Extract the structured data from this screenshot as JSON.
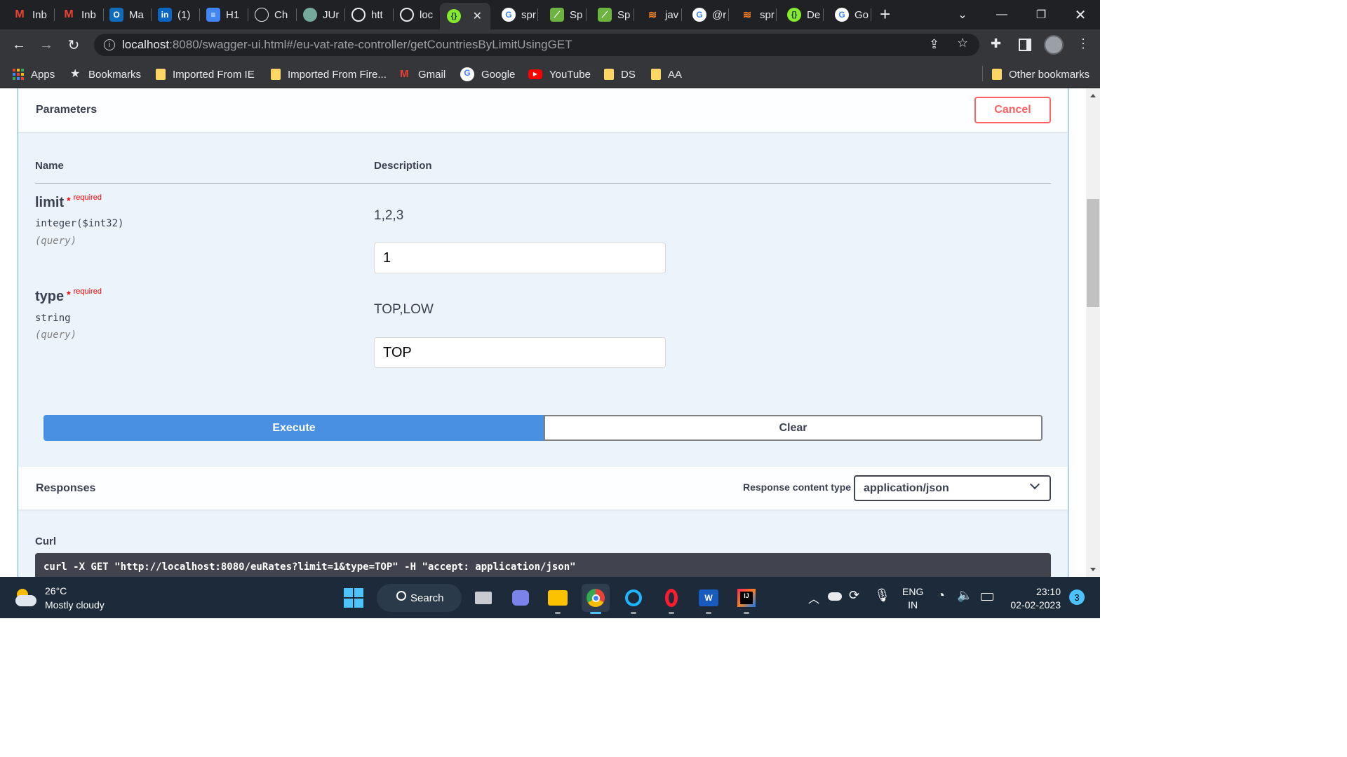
{
  "browser": {
    "tabs": [
      {
        "label": "Inb",
        "icon": "gmail-icon",
        "color": "#ea4335"
      },
      {
        "label": "Inb",
        "icon": "gmail-icon",
        "color": "#ea4335"
      },
      {
        "label": "Ma",
        "icon": "outlook-icon",
        "color": "#0f6cbd"
      },
      {
        "label": "(1)",
        "icon": "linkedin-icon",
        "color": "#0a66c2"
      },
      {
        "label": "H1",
        "icon": "docs-icon",
        "color": "#4285f4"
      },
      {
        "label": "Ch",
        "icon": "openai-icon",
        "color": "#202124"
      },
      {
        "label": "JUr",
        "icon": "openai-icon",
        "color": "#74aa9c"
      },
      {
        "label": "htt",
        "icon": "globe-icon",
        "color": "#5f6368"
      },
      {
        "label": "loc",
        "icon": "globe-icon",
        "color": "#5f6368"
      },
      {
        "label": "",
        "icon": "swagger-icon",
        "color": "#85ea2d",
        "active": true
      },
      {
        "label": "spr",
        "icon": "google-icon",
        "color": "#ffffff"
      },
      {
        "label": "Sp",
        "icon": "spring-icon",
        "color": "#6db33f"
      },
      {
        "label": "Sp",
        "icon": "spring-icon",
        "color": "#6db33f"
      },
      {
        "label": "jav",
        "icon": "stackoverflow-icon",
        "color": "#f48024"
      },
      {
        "label": "@r",
        "icon": "google-icon",
        "color": "#ffffff"
      },
      {
        "label": "spr",
        "icon": "stackoverflow-icon",
        "color": "#f48024"
      },
      {
        "label": "De",
        "icon": "swagger-icon",
        "color": "#85ea2d"
      },
      {
        "label": "Go",
        "icon": "google-icon",
        "color": "#ffffff"
      }
    ],
    "url_host": "localhost",
    "url_rest": ":8080/swagger-ui.html#/eu-vat-rate-controller/getCountriesByLimitUsingGET",
    "bookmarks": [
      {
        "label": "Apps",
        "icon": "apps-icon"
      },
      {
        "label": "Bookmarks",
        "icon": "star-icon"
      },
      {
        "label": "Imported From IE",
        "icon": "folder-icon"
      },
      {
        "label": "Imported From Fire...",
        "icon": "folder-icon"
      },
      {
        "label": "Gmail",
        "icon": "gmail-icon"
      },
      {
        "label": "Google",
        "icon": "google-icon"
      },
      {
        "label": "YouTube",
        "icon": "youtube-icon"
      },
      {
        "label": "DS",
        "icon": "folder-icon"
      },
      {
        "label": "AA",
        "icon": "folder-icon"
      }
    ],
    "other_bookmarks": "Other bookmarks"
  },
  "swagger": {
    "parameters_title": "Parameters",
    "cancel_label": "Cancel",
    "col_name": "Name",
    "col_description": "Description",
    "params": [
      {
        "name": "limit",
        "star": "*",
        "required": "required",
        "type": "integer($int32)",
        "in": "(query)",
        "description": "1,2,3",
        "value": "1"
      },
      {
        "name": "type",
        "star": "*",
        "required": "required",
        "type": "string",
        "in": "(query)",
        "description": "TOP,LOW",
        "value": "TOP"
      }
    ],
    "execute_label": "Execute",
    "clear_label": "Clear",
    "responses_title": "Responses",
    "response_content_type_label": "Response content type",
    "response_content_type_value": "application/json",
    "curl_title": "Curl",
    "curl_command": "curl -X GET \"http://localhost:8080/euRates?limit=1&type=TOP\" -H \"accept: application/json\""
  },
  "taskbar": {
    "temperature": "26°C",
    "weather": "Mostly cloudy",
    "search_label": "Search",
    "lang_top": "ENG",
    "lang_bottom": "IN",
    "time": "23:10",
    "date": "02-02-2023",
    "notifications": "3"
  },
  "colors": {
    "swagger_blue": "#61affe",
    "execute_blue": "#4990e2",
    "cancel_red": "#ff6060",
    "required_red": "#ff0000"
  }
}
